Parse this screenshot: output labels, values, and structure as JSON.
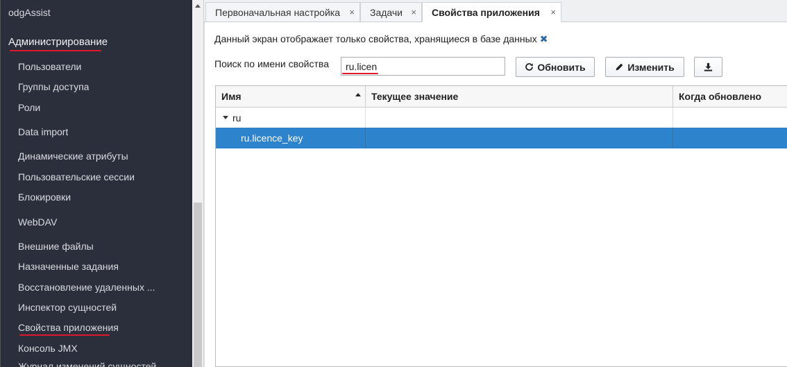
{
  "sidebar": {
    "app_title": "odgAssist",
    "section": "Администрирование",
    "items": [
      {
        "label": "Пользователи"
      },
      {
        "label": "Группы доступа"
      },
      {
        "label": "Роли"
      },
      {
        "label": "Data import"
      },
      {
        "label": "Динамические атрибуты"
      },
      {
        "label": "Пользовательские сессии"
      },
      {
        "label": "Блокировки"
      },
      {
        "label": "WebDAV"
      },
      {
        "label": "Внешние файлы"
      },
      {
        "label": "Назначенные задания"
      },
      {
        "label": "Восстановление удаленных ..."
      },
      {
        "label": "Инспектор сущностей"
      },
      {
        "label": "Свойства приложения"
      },
      {
        "label": "Консоль JMX"
      },
      {
        "label": "Журнал изменений сущностей"
      }
    ]
  },
  "tabs": [
    {
      "label": "Первоначальная настройка",
      "close": "×"
    },
    {
      "label": "Задачи",
      "close": "×"
    },
    {
      "label": "Свойства приложения",
      "close": "×",
      "active": true
    }
  ],
  "content": {
    "info_text": "Данный экран отображает только свойства, хранящиеся в базе данных",
    "info_close": "✖",
    "search_label": "Поиск по имени свойства",
    "search_value": "ru.licen",
    "refresh_label": "Обновить",
    "edit_label": "Изменить"
  },
  "table": {
    "columns": [
      "Имя",
      "Текущее значение",
      "Когда обновлено"
    ],
    "rows": [
      {
        "name": "ru",
        "value": "",
        "updated": ""
      },
      {
        "name": "ru.licence_key",
        "value": "",
        "updated": ""
      }
    ]
  },
  "colors": {
    "sidebar_bg": "#2b2f3b",
    "selection": "#2d83cc",
    "annotation_red": "#e0182b"
  }
}
